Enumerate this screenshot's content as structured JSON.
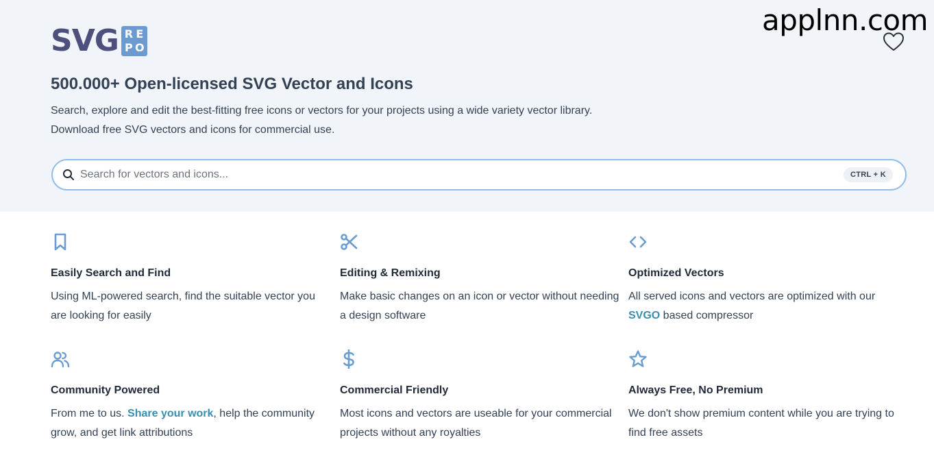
{
  "brand": {
    "logo_main": "SVG",
    "logo_badge": [
      "R",
      "E",
      "P",
      "O"
    ],
    "accent": "#6b9bd1",
    "logo_text_color": "#4d4f7c"
  },
  "watermark": "applnn.com",
  "header": {
    "favorites_icon": "heart-icon",
    "title": "500.000+ Open-licensed SVG Vector and Icons",
    "desc1": "Search, explore and edit the best-fitting free icons or vectors for your projects using a wide variety vector library.",
    "desc2": "Download free SVG vectors and icons for commercial use."
  },
  "search": {
    "placeholder": "Search for vectors and icons...",
    "value": "",
    "shortcut": "CTRL + K",
    "icon": "search-icon"
  },
  "features": [
    {
      "icon": "bookmark-icon",
      "title": "Easily Search and Find",
      "text": "Using ML-powered search, find the suitable vector you are looking for easily"
    },
    {
      "icon": "scissors-icon",
      "title": "Editing & Remixing",
      "text": "Make basic changes on an icon or vector without needing a design software"
    },
    {
      "icon": "code-icon",
      "title": "Optimized Vectors",
      "text_before": "All served icons and vectors are optimized with our ",
      "link": "SVGO",
      "text_after": " based compressor"
    },
    {
      "icon": "users-icon",
      "title": "Community Powered",
      "text_before": "From me to us. ",
      "link": "Share your work",
      "text_after": ", help the community grow, and get link attributions"
    },
    {
      "icon": "dollar-icon",
      "title": "Commercial Friendly",
      "text": "Most icons and vectors are useable for your commercial projects without any royalties"
    },
    {
      "icon": "star-icon",
      "title": "Always Free, No Premium",
      "text": "We don't show premium content while you are trying to find free assets"
    }
  ],
  "colors": {
    "hero_bg": "#f1f4f9",
    "icon": "#6b9bd1",
    "link": "#3a8fb0",
    "search_border": "#93bde6"
  }
}
